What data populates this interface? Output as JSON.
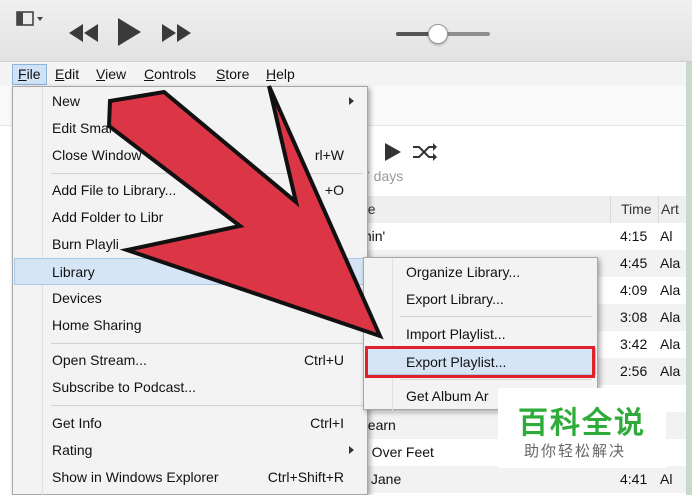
{
  "menubar": {
    "file": {
      "pre": "",
      "u": "F",
      "post": "ile"
    },
    "edit": {
      "pre": "",
      "u": "E",
      "post": "dit"
    },
    "view": {
      "pre": "",
      "u": "V",
      "post": "iew"
    },
    "controls": {
      "pre": "",
      "u": "C",
      "post": "ontrols"
    },
    "store": {
      "pre": "",
      "u": "S",
      "post": "tore"
    },
    "help": {
      "pre": "",
      "u": "H",
      "post": "elp"
    }
  },
  "player": {
    "volume_level": 0.45
  },
  "file_menu": {
    "new": "New",
    "edit_smart": "Edit Smart",
    "close_window": "Close Window",
    "close_window_shortcut": "rl+W",
    "add_file": "Add File to Library...",
    "add_file_shortcut": "+O",
    "add_folder": "Add Folder to Libr",
    "burn_playlist": "Burn Playli",
    "library": "Library",
    "devices": "Devices",
    "home_sharing": "Home Sharing",
    "open_stream": "Open Stream...",
    "open_stream_shortcut": "Ctrl+U",
    "subscribe_podcast": "Subscribe to Podcast...",
    "get_info": "Get Info",
    "get_info_shortcut": "Ctrl+I",
    "rating": "Rating",
    "show_in_explorer": "Show in Windows Explorer",
    "show_in_explorer_shortcut": "Ctrl+Shift+R"
  },
  "library_submenu": {
    "organize": "Organize Library...",
    "export_library": "Export Library...",
    "import_playlist": "Import Playlist...",
    "export_playlist": "Export Playlist...",
    "get_album_artwork": "Get Album Ar"
  },
  "playlist": {
    "duration": "7 days"
  },
  "tracklist": {
    "headers": {
      "name": "ne",
      "time": "Time",
      "artist": "Art"
    },
    "rows": [
      {
        "name": "min'",
        "time": "4:15",
        "artist": "Al"
      },
      {
        "name": "",
        "time": "4:45",
        "artist": "Ala"
      },
      {
        "name": "",
        "time": "4:09",
        "artist": "Ala"
      },
      {
        "name": "",
        "time": "3:08",
        "artist": "Ala"
      },
      {
        "name": "",
        "time": "3:42",
        "artist": "Ala"
      },
      {
        "name": "",
        "time": "2:56",
        "artist": "Ala"
      },
      {
        "name": "",
        "time": "",
        "artist": ""
      },
      {
        "name": "Learn",
        "time": "",
        "artist": ""
      },
      {
        "name": "d Over Feet",
        "time": "",
        "artist": ""
      },
      {
        "name": "y Jane",
        "time": "4:41",
        "artist": "Al"
      }
    ]
  },
  "watermark": {
    "title": "百科全说",
    "subtitle": "助你轻松解决"
  },
  "colors": {
    "arrow_fill": "#dc3545",
    "arrow_stroke": "#111111",
    "highlight_box": "#e0202a",
    "watermark_green": "#2eab39"
  }
}
